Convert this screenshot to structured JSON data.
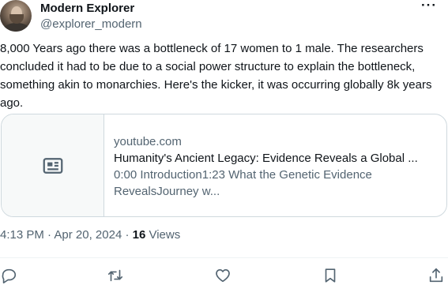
{
  "author": {
    "display_name": "Modern Explorer",
    "handle": "@explorer_modern"
  },
  "more_label": "···",
  "tweet": {
    "text": "8,000 Years ago there was a bottleneck of 17 women to 1 male. The researchers concluded it had to be due to a social power structure to explain the bottleneck, something akin to monarchies. Here's the kicker, it was occurring globally 8k years ago."
  },
  "card": {
    "domain": "youtube.com",
    "title": "Humanity's Ancient Legacy: Evidence Reveals a Global ...",
    "description": "0:00 Introduction1:23 What the Genetic Evidence RevealsJourney w...",
    "thumbnail_icon": "news-article-icon"
  },
  "meta": {
    "time": "4:13 PM",
    "separator": " · ",
    "date": "Apr 20, 2024",
    "views_count": "16",
    "views_label": " Views"
  },
  "actions": [
    {
      "name": "reply",
      "icon": "reply-icon"
    },
    {
      "name": "retweet",
      "icon": "retweet-icon"
    },
    {
      "name": "like",
      "icon": "heart-icon"
    },
    {
      "name": "bookmark",
      "icon": "bookmark-icon"
    },
    {
      "name": "share",
      "icon": "share-icon"
    }
  ],
  "colors": {
    "text_primary": "#0f1419",
    "text_secondary": "#536471",
    "border": "#cfd9de",
    "thumb_bg": "#f7f9f9"
  }
}
